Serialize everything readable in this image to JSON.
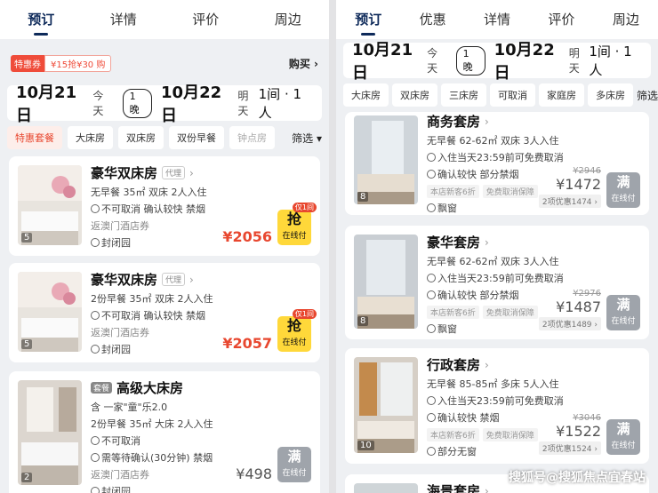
{
  "left": {
    "tabs": [
      "预订",
      "详情",
      "评价",
      "周边"
    ],
    "promo": {
      "badge": "特惠券",
      "text": "¥15抢¥30 购",
      "buy": "购买 ›"
    },
    "date": {
      "checkin": "10月21日",
      "checkin_label": "今天",
      "nights": "1晚",
      "checkout": "10月22日",
      "checkout_label": "明天",
      "rooms": "1间 · 1人"
    },
    "filters": [
      "特惠套餐",
      "大床房",
      "双床房",
      "双份早餐",
      "钟点房"
    ],
    "filter_button": "筛选 ▾",
    "cards": [
      {
        "title": "豪华双床房",
        "tag": "代理",
        "line1": "无早餐  35㎡  双床  2人入住",
        "line2": "不可取消  确认较快  禁烟",
        "line3": "返澳门酒店券",
        "line4": "封闭园",
        "price": "¥2056",
        "action": "抢",
        "action_sub": "在线付",
        "flag": "仅1间",
        "photo_count": "5"
      },
      {
        "title": "豪华双床房",
        "tag": "代理",
        "line1": "2份早餐  35㎡  双床  2人入住",
        "line2": "不可取消  确认较快  禁烟",
        "line3": "返澳门酒店券",
        "line4": "封闭园",
        "price": "¥2057",
        "action": "抢",
        "action_sub": "在线付",
        "flag": "仅1间",
        "photo_count": "5"
      },
      {
        "title": "高级大床房",
        "tag": "套餐",
        "line0": "含 一家\"童\"乐2.0",
        "line1": "2份早餐  35㎡  大床  2人入住",
        "line2": "不可取消",
        "line2b": "需等待确认(30分钟)  禁烟",
        "line3": "返澳门酒店券",
        "line4": "封闭园",
        "price": "¥498",
        "action": "满",
        "action_sub": "在线付",
        "photo_count": "2"
      }
    ]
  },
  "right": {
    "tabs": [
      "预订",
      "优惠",
      "详情",
      "评价",
      "周边"
    ],
    "date": {
      "checkin": "10月21日",
      "checkin_label": "今天",
      "nights": "1晚",
      "checkout": "10月22日",
      "checkout_label": "明天",
      "rooms": "1间 · 1人"
    },
    "filters": [
      "大床房",
      "双床房",
      "三床房",
      "可取消",
      "家庭房",
      "多床房"
    ],
    "filter_button": "筛选 ▾",
    "cards": [
      {
        "title": "商务套房",
        "line1": "无早餐  62-62㎡  双床  3人入住",
        "line2": "入住当天23:59前可免费取消",
        "line3": "确认较快  部分禁烟",
        "tags": [
          "本店新客6折",
          "免费取消保障"
        ],
        "line4": "飘窗",
        "orig": "¥2946",
        "price": "¥1472",
        "discount": "2项优惠1474 ›",
        "action": "满",
        "action_sub": "在线付",
        "photo_count": "8"
      },
      {
        "title": "豪华套房",
        "line1": "无早餐  62-62㎡  双床  3人入住",
        "line2": "入住当天23:59前可免费取消",
        "line3": "确认较快  部分禁烟",
        "tags": [
          "本店新客6折",
          "免费取消保障"
        ],
        "line4": "飘窗",
        "orig": "¥2976",
        "price": "¥1487",
        "discount": "2项优惠1489 ›",
        "action": "满",
        "action_sub": "在线付",
        "photo_count": "8"
      },
      {
        "title": "行政套房",
        "line1": "无早餐  85-85㎡  多床  5人入住",
        "line2": "入住当天23:59前可免费取消",
        "line3": "确认较快  禁烟",
        "tags": [
          "本店新客6折",
          "免费取消保障"
        ],
        "line4": "部分无窗",
        "orig": "¥3046",
        "price": "¥1522",
        "discount": "2项优惠1524 ›",
        "action": "满",
        "action_sub": "在线付",
        "photo_count": "10"
      },
      {
        "title": "海景套房"
      }
    ]
  },
  "watermark": "搜狐号@搜狐焦点宜春站"
}
